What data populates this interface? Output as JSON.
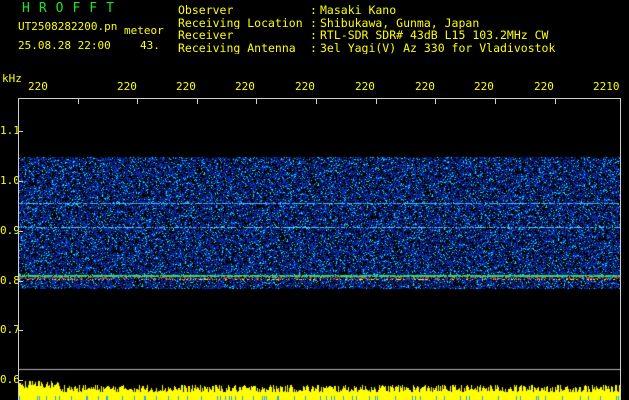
{
  "header": {
    "brand": "HROFFT",
    "filename": "UT2508282200.pn",
    "tag": "meteor",
    "datetime": "25.08.28 22:00",
    "count": "43.",
    "meta": [
      {
        "key": "Observer",
        "sep": ":",
        "value": "Masaki Kano"
      },
      {
        "key": "Receiving Location",
        "sep": ":",
        "value": "Shibukawa, Gunma, Japan"
      },
      {
        "key": "Receiver",
        "sep": ":",
        "value": "RTL-SDR SDR# 43dB L15 103.2MHz CW"
      },
      {
        "key": "Receiving Antenna",
        "sep": ":",
        "value": "3el Yagi(V) Az 330 for Vladivostok"
      }
    ]
  },
  "axis": {
    "unit": "kHz",
    "x_ticks": [
      "220",
      "220",
      "220",
      "220",
      "220",
      "220",
      "220",
      "220",
      "220",
      "2210"
    ],
    "y_ticks": [
      "1.1",
      "1.0",
      "0.9",
      "0.8",
      "0.7",
      "0.6"
    ]
  },
  "colors": {
    "label": "#ffff00",
    "brand": "#1fe41f",
    "frame": "#cfcfcf",
    "noise_low": "#0a1a8c",
    "noise_high": "#00a0ff",
    "echo_line": "#ff3030",
    "meter": "#ffff00"
  }
}
